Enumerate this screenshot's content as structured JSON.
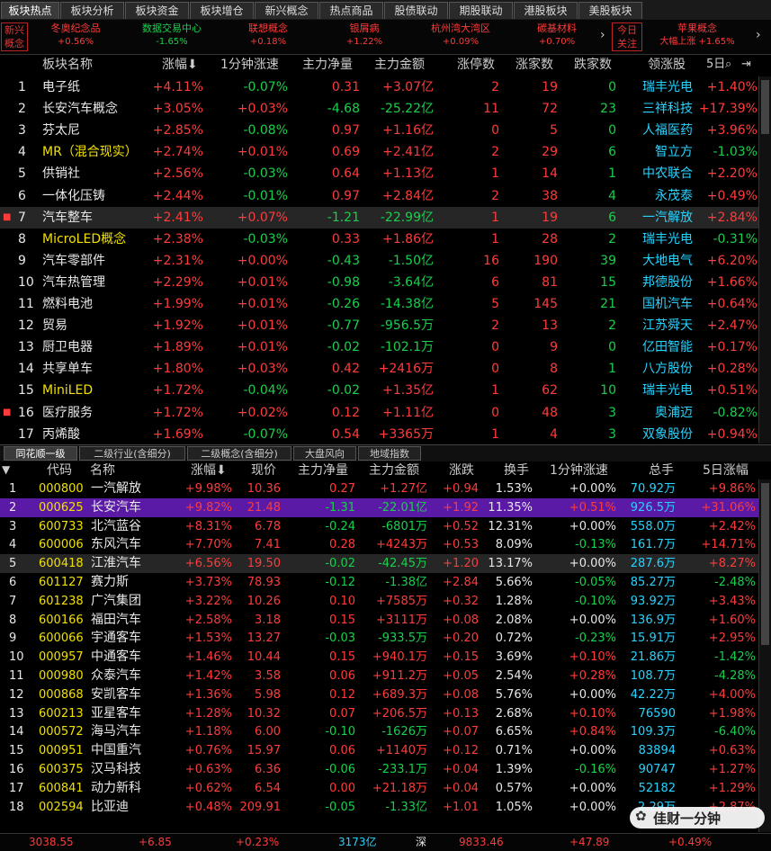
{
  "top_tabs": [
    "板块热点",
    "板块分析",
    "板块资金",
    "板块增仓",
    "新兴概念",
    "热点商品",
    "股债联动",
    "期股联动",
    "港股板块",
    "美股板块"
  ],
  "strip": {
    "left_box": "新兴概念",
    "items": [
      {
        "name": "冬奥纪念品",
        "val": "+0.56%",
        "up": true
      },
      {
        "name": "数据交易中心",
        "val": "-1.65%",
        "up": false
      },
      {
        "name": "联想概念",
        "val": "+0.18%",
        "up": true
      },
      {
        "name": "银屑病",
        "val": "+1.22%",
        "up": true
      },
      {
        "name": "杭州湾大湾区",
        "val": "+0.09%",
        "up": true
      },
      {
        "name": "碳基材料",
        "val": "+0.70%",
        "up": true
      }
    ],
    "right_box": "今日关注",
    "right_item": {
      "name": "苹果概念",
      "val": "大幅上涨 +1.65%"
    }
  },
  "sector_table": {
    "headers": [
      "板块名称",
      "涨幅",
      "1分钟涨速",
      "主力净量",
      "主力金额",
      "涨停数",
      "涨家数",
      "跌家数",
      "领涨股",
      "5日"
    ],
    "rows": [
      {
        "no": "1",
        "name": "电子纸",
        "chg": "+4.11%",
        "spd": "-0.07%",
        "net": "0.31",
        "amt": "+3.07亿",
        "lim": "2",
        "up": "19",
        "dn": "0",
        "lead": "瑞丰光电",
        "lchg": "+1.40%"
      },
      {
        "no": "2",
        "name": "长安汽车概念",
        "chg": "+3.05%",
        "spd": "+0.03%",
        "net": "-4.68",
        "amt": "-25.22亿",
        "lim": "11",
        "up": "72",
        "dn": "23",
        "lead": "三祥科技",
        "lchg": "+17.39%"
      },
      {
        "no": "3",
        "name": "芬太尼",
        "chg": "+2.85%",
        "spd": "-0.08%",
        "net": "0.97",
        "amt": "+1.16亿",
        "lim": "0",
        "up": "5",
        "dn": "0",
        "lead": "人福医药",
        "lchg": "+3.96%"
      },
      {
        "no": "4",
        "name": "MR（混合现实）",
        "chg": "+2.74%",
        "spd": "+0.01%",
        "net": "0.69",
        "amt": "+2.41亿",
        "lim": "2",
        "up": "29",
        "dn": "6",
        "lead": "智立方",
        "lchg": "-1.03%"
      },
      {
        "no": "5",
        "name": "供销社",
        "chg": "+2.56%",
        "spd": "-0.03%",
        "net": "0.64",
        "amt": "+1.13亿",
        "lim": "1",
        "up": "14",
        "dn": "1",
        "lead": "中农联合",
        "lchg": "+2.20%"
      },
      {
        "no": "6",
        "name": "一体化压铸",
        "chg": "+2.44%",
        "spd": "-0.01%",
        "net": "0.97",
        "amt": "+2.84亿",
        "lim": "2",
        "up": "38",
        "dn": "4",
        "lead": "永茂泰",
        "lchg": "+0.49%"
      },
      {
        "no": "7",
        "name": "汽车整车",
        "chg": "+2.41%",
        "spd": "+0.07%",
        "net": "-1.21",
        "amt": "-22.99亿",
        "lim": "1",
        "up": "19",
        "dn": "6",
        "lead": "一汽解放",
        "lchg": "+2.84%"
      },
      {
        "no": "8",
        "name": "MicroLED概念",
        "chg": "+2.38%",
        "spd": "-0.03%",
        "net": "0.33",
        "amt": "+1.86亿",
        "lim": "1",
        "up": "28",
        "dn": "2",
        "lead": "瑞丰光电",
        "lchg": "-0.31%"
      },
      {
        "no": "9",
        "name": "汽车零部件",
        "chg": "+2.31%",
        "spd": "+0.00%",
        "net": "-0.43",
        "amt": "-1.50亿",
        "lim": "16",
        "up": "190",
        "dn": "39",
        "lead": "大地电气",
        "lchg": "+6.20%"
      },
      {
        "no": "10",
        "name": "汽车热管理",
        "chg": "+2.29%",
        "spd": "+0.01%",
        "net": "-0.98",
        "amt": "-3.64亿",
        "lim": "6",
        "up": "81",
        "dn": "15",
        "lead": "邦德股份",
        "lchg": "+1.66%"
      },
      {
        "no": "11",
        "name": "燃料电池",
        "chg": "+1.99%",
        "spd": "+0.01%",
        "net": "-0.26",
        "amt": "-14.38亿",
        "lim": "5",
        "up": "145",
        "dn": "21",
        "lead": "国机汽车",
        "lchg": "+0.64%"
      },
      {
        "no": "12",
        "name": "贸易",
        "chg": "+1.92%",
        "spd": "+0.01%",
        "net": "-0.77",
        "amt": "-956.5万",
        "lim": "2",
        "up": "13",
        "dn": "2",
        "lead": "江苏舜天",
        "lchg": "+2.47%"
      },
      {
        "no": "13",
        "name": "厨卫电器",
        "chg": "+1.89%",
        "spd": "+0.01%",
        "net": "-0.02",
        "amt": "-102.1万",
        "lim": "0",
        "up": "9",
        "dn": "0",
        "lead": "亿田智能",
        "lchg": "+0.17%"
      },
      {
        "no": "14",
        "name": "共享单车",
        "chg": "+1.80%",
        "spd": "+0.03%",
        "net": "0.42",
        "amt": "+2416万",
        "lim": "0",
        "up": "8",
        "dn": "1",
        "lead": "八方股份",
        "lchg": "+0.28%"
      },
      {
        "no": "15",
        "name": "MiniLED",
        "chg": "+1.72%",
        "spd": "-0.04%",
        "net": "-0.02",
        "amt": "+1.35亿",
        "lim": "1",
        "up": "62",
        "dn": "10",
        "lead": "瑞丰光电",
        "lchg": "+0.51%"
      },
      {
        "no": "16",
        "name": "医疗服务",
        "chg": "+1.72%",
        "spd": "+0.02%",
        "net": "0.12",
        "amt": "+1.11亿",
        "lim": "0",
        "up": "48",
        "dn": "3",
        "lead": "奥浦迈",
        "lchg": "-0.82%"
      },
      {
        "no": "17",
        "name": "丙烯酸",
        "chg": "+1.69%",
        "spd": "-0.07%",
        "net": "0.54",
        "amt": "+3365万",
        "lim": "1",
        "up": "4",
        "dn": "3",
        "lead": "双象股份",
        "lchg": "+0.94%"
      }
    ]
  },
  "bottom_tabs": [
    "同花顺一级",
    "二级行业(含细分)",
    "二级概念(含细分)",
    "大盘风向",
    "地域指数"
  ],
  "stock_table": {
    "headers": [
      "代码",
      "名称",
      "涨幅",
      "现价",
      "主力净量",
      "主力金额",
      "涨跌",
      "换手",
      "1分钟涨速",
      "总手",
      "5日涨幅"
    ],
    "rows": [
      {
        "no": "1",
        "code": "000800",
        "name": "一汽解放",
        "chg": "+9.98%",
        "price": "10.36",
        "net": "0.27",
        "amt": "+1.27亿",
        "diff": "+0.94",
        "turn": "1.53%",
        "spd": "+0.00%",
        "vol": "70.92万",
        "d5": "+9.86%"
      },
      {
        "no": "2",
        "code": "000625",
        "name": "长安汽车",
        "chg": "+9.82%",
        "price": "21.48",
        "net": "-1.31",
        "amt": "-22.01亿",
        "diff": "+1.92",
        "turn": "11.35%",
        "spd": "+0.51%",
        "vol": "926.5万",
        "d5": "+31.06%"
      },
      {
        "no": "3",
        "code": "600733",
        "name": "北汽蓝谷",
        "chg": "+8.31%",
        "price": "6.78",
        "net": "-0.24",
        "amt": "-6801万",
        "diff": "+0.52",
        "turn": "12.31%",
        "spd": "+0.00%",
        "vol": "558.0万",
        "d5": "+2.42%"
      },
      {
        "no": "4",
        "code": "600006",
        "name": "东风汽车",
        "chg": "+7.70%",
        "price": "7.41",
        "net": "0.28",
        "amt": "+4243万",
        "diff": "+0.53",
        "turn": "8.09%",
        "spd": "-0.13%",
        "vol": "161.7万",
        "d5": "+14.71%"
      },
      {
        "no": "5",
        "code": "600418",
        "name": "江淮汽车",
        "chg": "+6.56%",
        "price": "19.50",
        "net": "-0.02",
        "amt": "-42.45万",
        "diff": "+1.20",
        "turn": "13.17%",
        "spd": "+0.00%",
        "vol": "287.6万",
        "d5": "+8.27%"
      },
      {
        "no": "6",
        "code": "601127",
        "name": "赛力斯",
        "chg": "+3.73%",
        "price": "78.93",
        "net": "-0.12",
        "amt": "-1.38亿",
        "diff": "+2.84",
        "turn": "5.66%",
        "spd": "-0.05%",
        "vol": "85.27万",
        "d5": "-2.48%"
      },
      {
        "no": "7",
        "code": "601238",
        "name": "广汽集团",
        "chg": "+3.22%",
        "price": "10.26",
        "net": "0.10",
        "amt": "+7585万",
        "diff": "+0.32",
        "turn": "1.28%",
        "spd": "-0.10%",
        "vol": "93.92万",
        "d5": "+3.43%"
      },
      {
        "no": "8",
        "code": "600166",
        "name": "福田汽车",
        "chg": "+2.58%",
        "price": "3.18",
        "net": "0.15",
        "amt": "+3111万",
        "diff": "+0.08",
        "turn": "2.08%",
        "spd": "+0.00%",
        "vol": "136.9万",
        "d5": "+1.60%"
      },
      {
        "no": "9",
        "code": "600066",
        "name": "宇通客车",
        "chg": "+1.53%",
        "price": "13.27",
        "net": "-0.03",
        "amt": "-933.5万",
        "diff": "+0.20",
        "turn": "0.72%",
        "spd": "-0.23%",
        "vol": "15.91万",
        "d5": "+2.95%"
      },
      {
        "no": "10",
        "code": "000957",
        "name": "中通客车",
        "chg": "+1.46%",
        "price": "10.44",
        "net": "0.15",
        "amt": "+940.1万",
        "diff": "+0.15",
        "turn": "3.69%",
        "spd": "+0.10%",
        "vol": "21.86万",
        "d5": "-1.42%"
      },
      {
        "no": "11",
        "code": "000980",
        "name": "众泰汽车",
        "chg": "+1.42%",
        "price": "3.58",
        "net": "0.06",
        "amt": "+911.2万",
        "diff": "+0.05",
        "turn": "2.54%",
        "spd": "+0.28%",
        "vol": "108.7万",
        "d5": "-4.28%"
      },
      {
        "no": "12",
        "code": "000868",
        "name": "安凯客车",
        "chg": "+1.36%",
        "price": "5.98",
        "net": "0.12",
        "amt": "+689.3万",
        "diff": "+0.08",
        "turn": "5.76%",
        "spd": "+0.00%",
        "vol": "42.22万",
        "d5": "+4.00%"
      },
      {
        "no": "13",
        "code": "600213",
        "name": "亚星客车",
        "chg": "+1.28%",
        "price": "10.32",
        "net": "0.07",
        "amt": "+206.5万",
        "diff": "+0.13",
        "turn": "2.68%",
        "spd": "+0.10%",
        "vol": "76590",
        "d5": "+1.98%"
      },
      {
        "no": "14",
        "code": "000572",
        "name": "海马汽车",
        "chg": "+1.18%",
        "price": "6.00",
        "net": "-0.10",
        "amt": "-1626万",
        "diff": "+0.07",
        "turn": "6.65%",
        "spd": "+0.84%",
        "vol": "109.3万",
        "d5": "-6.40%"
      },
      {
        "no": "15",
        "code": "000951",
        "name": "中国重汽",
        "chg": "+0.76%",
        "price": "15.97",
        "net": "0.06",
        "amt": "+1140万",
        "diff": "+0.12",
        "turn": "0.71%",
        "spd": "+0.00%",
        "vol": "83894",
        "d5": "+0.63%"
      },
      {
        "no": "16",
        "code": "600375",
        "name": "汉马科技",
        "chg": "+0.63%",
        "price": "6.36",
        "net": "-0.06",
        "amt": "-233.1万",
        "diff": "+0.04",
        "turn": "1.39%",
        "spd": "-0.16%",
        "vol": "90747",
        "d5": "+1.27%"
      },
      {
        "no": "17",
        "code": "600841",
        "name": "动力新科",
        "chg": "+0.62%",
        "price": "6.54",
        "net": "0.00",
        "amt": "+21.18万",
        "diff": "+0.04",
        "turn": "0.57%",
        "spd": "+0.00%",
        "vol": "52182",
        "d5": "+1.29%"
      },
      {
        "no": "18",
        "code": "002594",
        "name": "比亚迪",
        "chg": "+0.48%",
        "price": "209.91",
        "net": "-0.05",
        "amt": "-1.33亿",
        "diff": "+1.01",
        "turn": "1.05%",
        "spd": "+0.00%",
        "vol": "2.29万",
        "d5": "+2.87%"
      }
    ]
  },
  "watermark": "佳财一分钟",
  "status": {
    "sh_index": "3038.55",
    "sh_chg": "+6.85",
    "sh_pct": "+0.23%",
    "amount": "3173亿",
    "sz_label": "深",
    "sz_index": "9833.46",
    "sz_chg": "+47.89",
    "sz_pct": "+0.49%"
  },
  "colors": {
    "up": "#ff3b3b",
    "down": "#18d04c",
    "lead": "#27d3ff",
    "highlight": "#5a1aa6"
  }
}
